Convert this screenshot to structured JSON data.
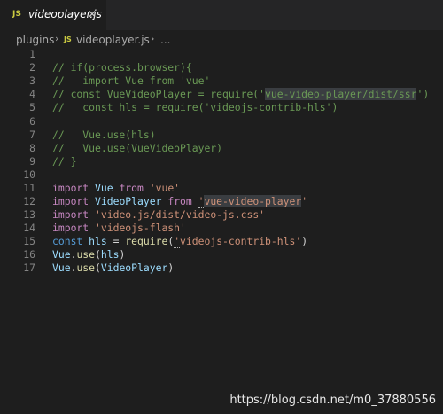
{
  "tab": {
    "icon_text": "JS",
    "title": "videoplayer.js",
    "close": "✕"
  },
  "breadcrumb": {
    "folder": "plugins",
    "file_icon_text": "JS",
    "file": "videoplayer.js",
    "ellipsis": "..."
  },
  "code": {
    "line_numbers": [
      "1",
      "2",
      "3",
      "4",
      "5",
      "6",
      "7",
      "8",
      "9",
      "10",
      "11",
      "12",
      "13",
      "14",
      "15",
      "16",
      "17"
    ],
    "l2": "// if(process.browser){",
    "l3": "//   import Vue from 'vue'",
    "l4a": "// const VueVideoPlayer = require('",
    "l4b": "vue-video-player/dist/ssr",
    "l4c": "')",
    "l5": "//   const hls = require('videojs-contrib-hls')",
    "l7": "//   Vue.use(hls)",
    "l8": "//   Vue.use(VueVideoPlayer)",
    "l9": "// }",
    "l11": {
      "kw": "import",
      "id": "Vue",
      "from": "from",
      "str": "'vue'"
    },
    "l12": {
      "kw": "import",
      "id": "VideoPlayer",
      "from": "from",
      "q": "'",
      "str": "vue-video-player",
      "q2": "'"
    },
    "l13": {
      "kw": "import",
      "str": "'video.js/dist/video-js.css'"
    },
    "l14": {
      "kw": "import",
      "str": "'videojs-flash'"
    },
    "l15": {
      "kw": "const",
      "id": "hls",
      "eq": "=",
      "fn": "require",
      "open": "(",
      "q": "'",
      "str": "videojs-contrib-hls'",
      "close": ")"
    },
    "l16": {
      "obj": "Vue",
      "dot": ".",
      "fn": "use",
      "open": "(",
      "arg": "hls",
      "close": ")"
    },
    "l17": {
      "obj": "Vue",
      "dot": ".",
      "fn": "use",
      "open": "(",
      "arg": "VideoPlayer",
      "close": ")"
    }
  },
  "watermark": "https://blog.csdn.net/m0_37880556",
  "colors": {
    "background": "#1e1e1e",
    "comment": "#6a9955",
    "keyword": "#c586c0",
    "variable": "#9cdcfe",
    "string": "#ce9178",
    "function": "#dcdcaa"
  }
}
